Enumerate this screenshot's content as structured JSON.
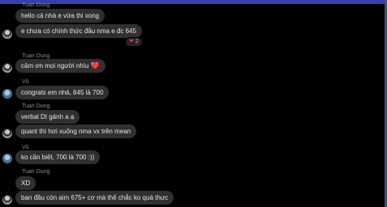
{
  "groups": [
    {
      "sender": "Tuan Dung",
      "messages": [
        "hello cả nhà e vừa thi xong",
        "e chưa có chính thức đầu nma e đc 645"
      ]
    },
    {
      "sender": "Tuan Dung",
      "messages": [
        "cảm ơn mọi người nhìu"
      ]
    },
    {
      "sender": "Vũ",
      "messages": [
        "congrats em nhá, 645 là 700"
      ]
    },
    {
      "sender": "Tuan Dung",
      "messages": [
        "verbal DI gánh a ạ",
        "quant thì hơi xuống nma vx trên mean"
      ]
    },
    {
      "sender": "Vũ",
      "messages": [
        "ko cần biết, 700 là 700 :))"
      ]
    },
    {
      "sender": "Tuan Dung",
      "messages": [
        "XD",
        "ban đầu còn aim 675+ cơ mà thế chắc ko quá thực"
      ]
    }
  ],
  "reaction": {
    "icon": "heart-icon",
    "count": "2"
  },
  "colors": {
    "bubble": "#303030",
    "background": "#000000",
    "heart": "#e0245e"
  }
}
